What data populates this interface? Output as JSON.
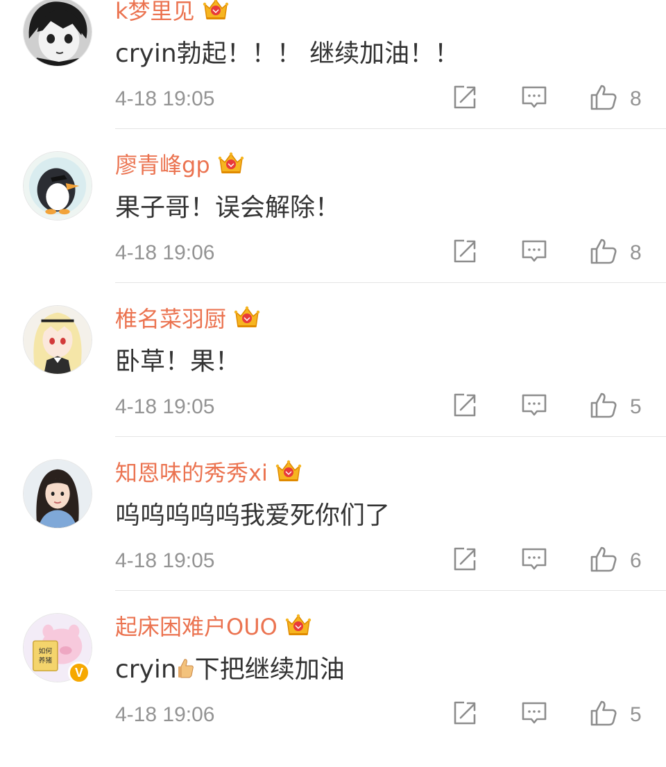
{
  "comments": [
    {
      "name": "k梦里见",
      "text": "cryin勃起！！！ 继续加油！！",
      "time": "4-18 19:05",
      "likes": "8"
    },
    {
      "name": "廖青峰gp",
      "text": "果子哥！误会解除！",
      "time": "4-18 19:06",
      "likes": "8"
    },
    {
      "name": "椎名菜羽厨",
      "text": "卧草！果！",
      "time": "4-18 19:05",
      "likes": "5"
    },
    {
      "name": "知恩味的秀秀xi",
      "text": "呜呜呜呜呜我爱死你们了",
      "time": "4-18 19:05",
      "likes": "6"
    },
    {
      "name": "起床困难户OUO",
      "text_before": "cryin",
      "text_after": "下把继续加油",
      "time": "4-18 19:06",
      "likes": "5",
      "verified": "V"
    }
  ],
  "colors": {
    "name": "#eb7350",
    "text": "#333333",
    "meta": "#939393",
    "divider": "#e4e4e4",
    "crown": "#f6b520"
  },
  "icons": [
    "crown-badge-icon",
    "share-icon",
    "comment-icon",
    "like-icon",
    "thumbs-up-emoji"
  ]
}
